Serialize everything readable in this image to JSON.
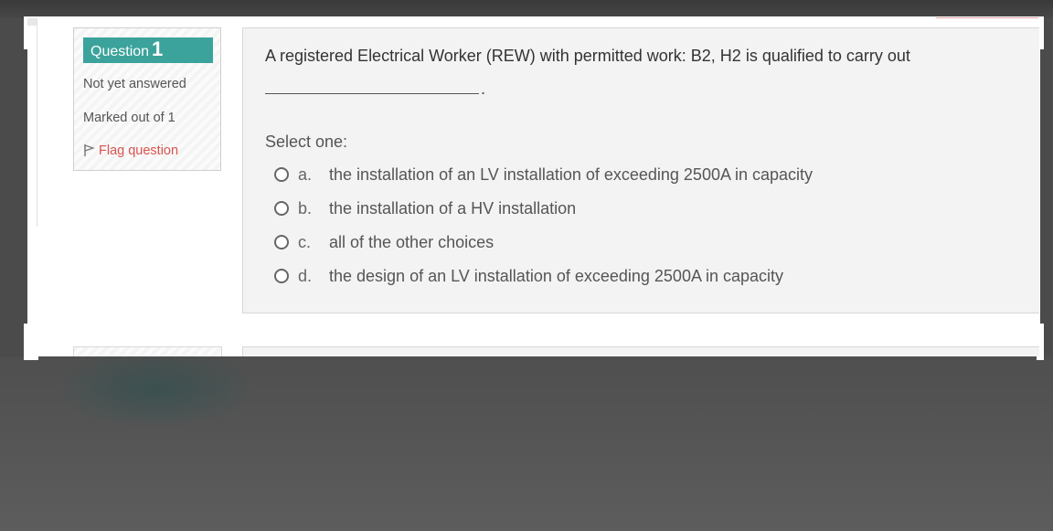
{
  "question_info": {
    "label": "Question",
    "number": "1",
    "state": "Not yet answered",
    "grade": "Marked out of 1",
    "flag_label": "Flag question"
  },
  "question": {
    "text": "A registered Electrical Worker (REW) with permitted work: B2, H2 is qualified to carry out",
    "blank_suffix": ".",
    "prompt": "Select one:",
    "options": [
      {
        "letter": "a.",
        "text": "the installation of an LV installation of exceeding 2500A in capacity"
      },
      {
        "letter": "b.",
        "text": "the installation of a HV installation"
      },
      {
        "letter": "c.",
        "text": "all of the other choices"
      },
      {
        "letter": "d.",
        "text": "the design of an LV installation of exceeding 2500A in capacity"
      }
    ]
  },
  "colors": {
    "question_badge": "#3ba39b",
    "flag": "#d9534f",
    "panel": "#f3f3f3"
  }
}
